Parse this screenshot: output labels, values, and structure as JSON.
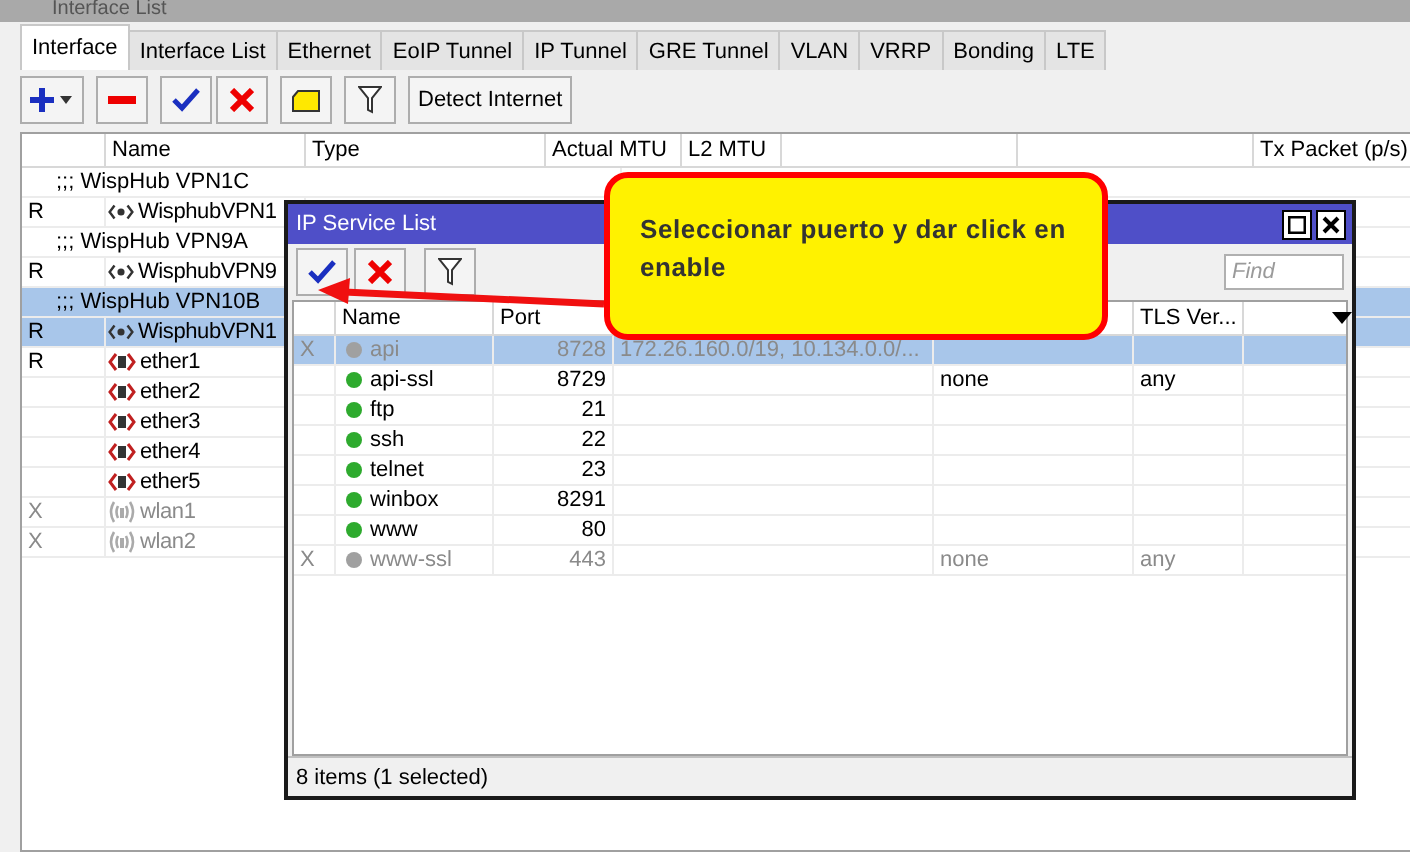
{
  "window": {
    "title": "Interface List"
  },
  "tabs": [
    {
      "label": "Interface",
      "selected": true
    },
    {
      "label": "Interface List",
      "selected": false
    },
    {
      "label": "Ethernet",
      "selected": false
    },
    {
      "label": "EoIP Tunnel",
      "selected": false
    },
    {
      "label": "IP Tunnel",
      "selected": false
    },
    {
      "label": "GRE Tunnel",
      "selected": false
    },
    {
      "label": "VLAN",
      "selected": false
    },
    {
      "label": "VRRP",
      "selected": false
    },
    {
      "label": "Bonding",
      "selected": false
    },
    {
      "label": "LTE",
      "selected": false
    }
  ],
  "toolbar": {
    "detect_button": "Detect Internet"
  },
  "table": {
    "columns": [
      "Name",
      "Type",
      "Actual MTU",
      "L2 MTU",
      "",
      "",
      "Tx Packet (p/s)"
    ],
    "rows": [
      {
        "kind": "comment",
        "name": ";;; WispHub VPN1C",
        "selected": false
      },
      {
        "kind": "vpn",
        "flag": "R",
        "name": "WisphubVPN1",
        "selected": false,
        "disabled": false
      },
      {
        "kind": "comment",
        "name": ";;; WispHub VPN9A",
        "selected": false
      },
      {
        "kind": "vpn",
        "flag": "R",
        "name": "WisphubVPN9",
        "selected": false,
        "disabled": false
      },
      {
        "kind": "comment",
        "name": ";;; WispHub VPN10B",
        "selected": true
      },
      {
        "kind": "vpn",
        "flag": "R",
        "name": "WisphubVPN1",
        "selected": true,
        "disabled": false
      },
      {
        "kind": "ether",
        "flag": "R",
        "name": "ether1",
        "selected": false,
        "disabled": false
      },
      {
        "kind": "ether",
        "name": "ether2",
        "selected": false,
        "disabled": false
      },
      {
        "kind": "ether",
        "name": "ether3",
        "selected": false,
        "disabled": false
      },
      {
        "kind": "ether",
        "name": "ether4",
        "selected": false,
        "disabled": false
      },
      {
        "kind": "ether",
        "name": "ether5",
        "selected": false,
        "disabled": false
      },
      {
        "kind": "wlan",
        "flag": "X",
        "name": "wlan1",
        "selected": false,
        "disabled": true
      },
      {
        "kind": "wlan",
        "flag": "X",
        "name": "wlan2",
        "selected": false,
        "disabled": true
      }
    ]
  },
  "service_window": {
    "title": "IP Service List",
    "find_placeholder": "Find",
    "columns": [
      "Name",
      "Port",
      "",
      "",
      "TLS Ver..."
    ],
    "rows": [
      {
        "flag": "X",
        "name": "api",
        "port": "8728",
        "available_from": "172.26.160.0/19, 10.134.0.0/...",
        "disabled": true,
        "selected": true
      },
      {
        "name": "api-ssl",
        "port": "8729",
        "certificate": "none",
        "tls_version": "any",
        "disabled": false,
        "selected": false
      },
      {
        "name": "ftp",
        "port": "21",
        "disabled": false,
        "selected": false
      },
      {
        "name": "ssh",
        "port": "22",
        "disabled": false,
        "selected": false
      },
      {
        "name": "telnet",
        "port": "23",
        "disabled": false,
        "selected": false
      },
      {
        "name": "winbox",
        "port": "8291",
        "disabled": false,
        "selected": false
      },
      {
        "name": "www",
        "port": "80",
        "disabled": false,
        "selected": false
      },
      {
        "flag": "X",
        "name": "www-ssl",
        "port": "443",
        "certificate": "none",
        "tls_version": "any",
        "disabled": true,
        "selected": false
      }
    ],
    "status": "8 items (1 selected)"
  },
  "callout": {
    "text": "Seleccionar puerto y dar click en enable"
  }
}
